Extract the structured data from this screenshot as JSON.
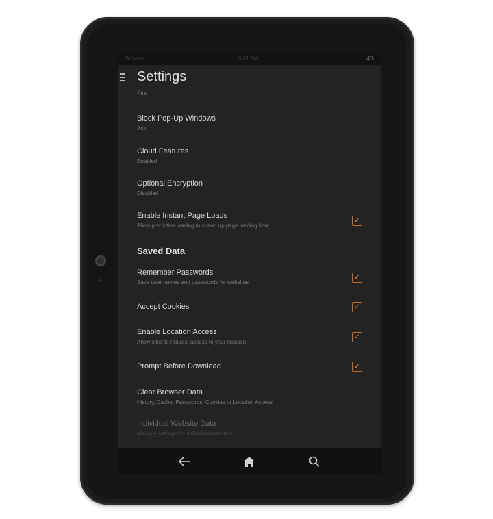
{
  "statusbar": {
    "left": "Browser",
    "center": "9:41 AM",
    "right": "4G"
  },
  "header": {
    "title": "Settings"
  },
  "faded_top_item": "Fire",
  "settings": [
    {
      "title": "Block Pop-Up Windows",
      "subtitle": "Ask",
      "checked": null
    },
    {
      "title": "Cloud Features",
      "subtitle": "Enabled",
      "checked": null
    },
    {
      "title": "Optional Encryption",
      "subtitle": "Disabled",
      "checked": null
    },
    {
      "title": "Enable Instant Page Loads",
      "subtitle": "Allow predictive loading to speed up page loading time",
      "checked": true
    }
  ],
  "saved_data": {
    "header": "Saved Data",
    "items": [
      {
        "title": "Remember Passwords",
        "subtitle": "Save user names and passwords for websites",
        "checked": true
      },
      {
        "title": "Accept Cookies",
        "subtitle": "",
        "checked": true
      },
      {
        "title": "Enable Location Access",
        "subtitle": "Allow sites to request access to your location",
        "checked": true
      },
      {
        "title": "Prompt Before Download",
        "subtitle": "",
        "checked": true
      },
      {
        "title": "Clear Browser Data",
        "subtitle": "History, Cache, Passwords, Cookies or Location Access",
        "checked": null
      },
      {
        "title": "Individual Website Data",
        "subtitle": "Manage settings for individual websites",
        "checked": null
      }
    ]
  },
  "navbar": {
    "back_icon": "back-arrow-icon",
    "home_icon": "home-icon",
    "search_icon": "search-icon"
  },
  "colors": {
    "accent": "#d9772b",
    "screen_bg": "#232323"
  },
  "checkmark": "✓"
}
